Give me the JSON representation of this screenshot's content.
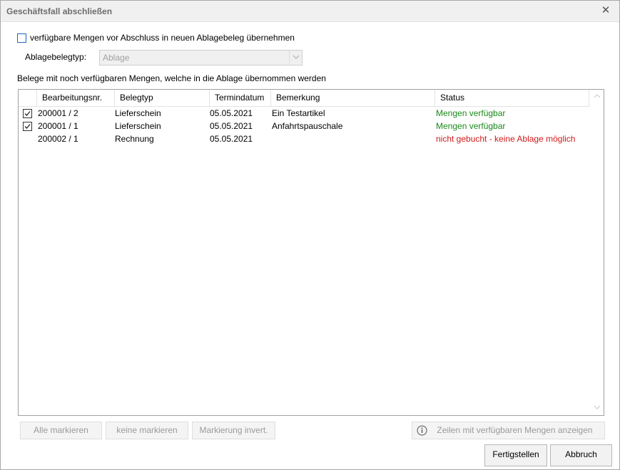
{
  "window": {
    "title": "Geschäftsfall abschließen",
    "close_glyph": "✕"
  },
  "options": {
    "transfer_checkbox_label": "verfügbare Mengen vor Abschluss in neuen Ablagebeleg übernehmen",
    "transfer_checked": false,
    "ablage_type_label": "Ablagebelegtyp:",
    "ablage_type_value": "Ablage"
  },
  "grid": {
    "caption": "Belege mit noch verfügbaren Mengen, welche in die Ablage übernommen werden",
    "columns": [
      "Bearbeitungsnr.",
      "Belegtyp",
      "Termindatum",
      "Bemerkung",
      "Status"
    ],
    "rows": [
      {
        "checked": true,
        "nr": "200001 / 2",
        "typ": "Lieferschein",
        "datum": "05.05.2021",
        "bemerkung": "Ein Testartikel",
        "status": "Mengen verfügbar",
        "status_color": "#1a8a1a"
      },
      {
        "checked": true,
        "nr": "200001 / 1",
        "typ": "Lieferschein",
        "datum": "05.05.2021",
        "bemerkung": "Anfahrtspauschale",
        "status": "Mengen verfügbar",
        "status_color": "#1a8a1a"
      },
      {
        "checked": false,
        "nr": "200002 / 1",
        "typ": "Rechnung",
        "datum": "05.05.2021",
        "bemerkung": "",
        "status": "nicht gebucht - keine Ablage möglich",
        "status_color": "#d11a1a"
      }
    ]
  },
  "buttons": {
    "mark_all": "Alle markieren",
    "mark_none": "keine markieren",
    "invert": "Markierung invert.",
    "show_rows": "Zeilen mit verfügbaren Mengen anzeigen",
    "finish": "Fertigstellen",
    "cancel": "Abbruch"
  },
  "icons": {
    "close": "close-icon",
    "info": "info-icon",
    "dropdown": "chevron-down-icon"
  }
}
